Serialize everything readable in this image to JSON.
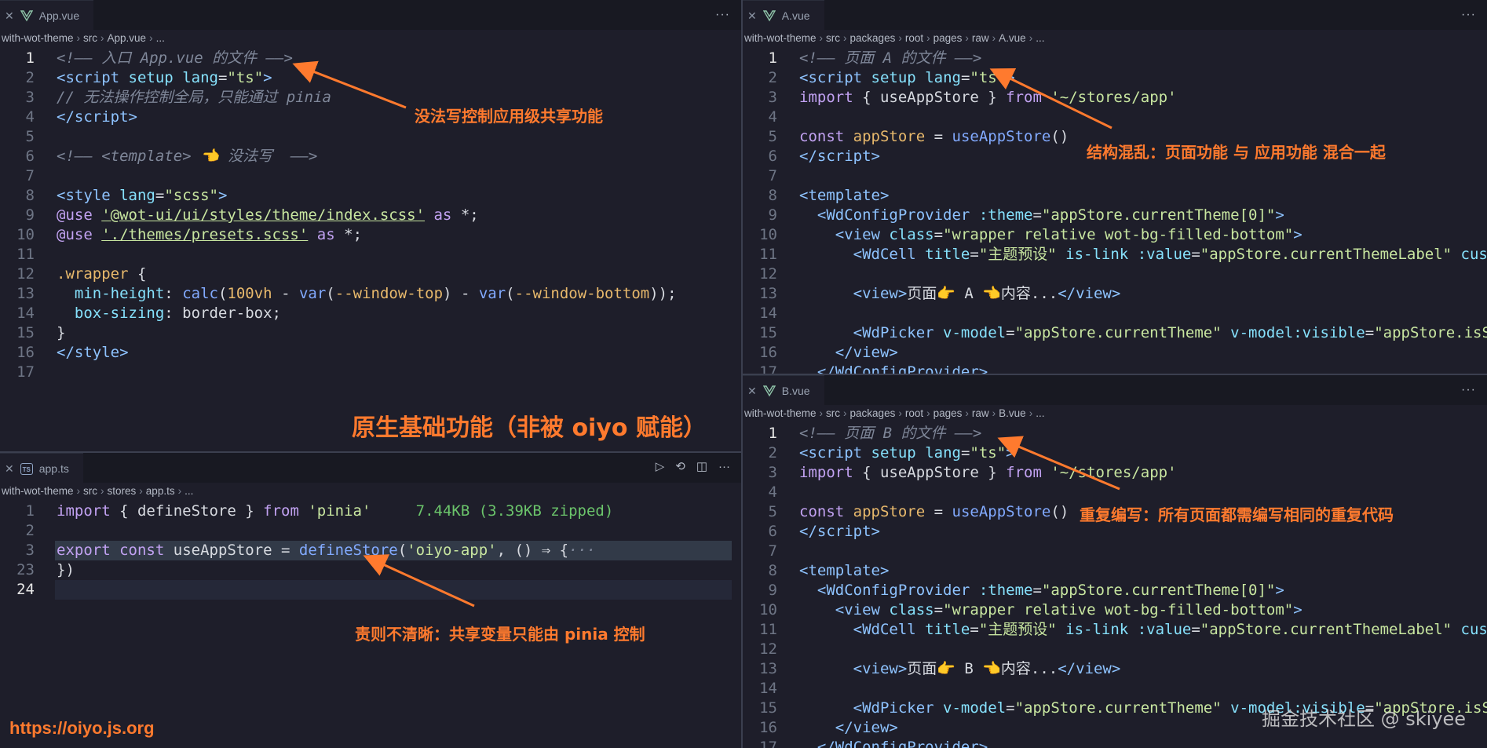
{
  "panes": {
    "app_vue": {
      "tab": "App.vue",
      "breadcrumb": [
        "with-wot-theme",
        "src",
        "App.vue",
        "..."
      ],
      "lines": [
        {
          "n": "1",
          "html": "<span class='c'>&lt;!—— 入口 App.vue 的文件 ——&gt;</span>"
        },
        {
          "n": "2",
          "html": "<span class='t'>&lt;script</span> <span class='a'>setup</span> <span class='a'>lang</span><span class='p'>=</span><span class='s'>\"ts\"</span><span class='t'>&gt;</span>"
        },
        {
          "n": "3",
          "html": "<span class='c'>// 无法操作控制全局，只能通过 pinia</span>"
        },
        {
          "n": "4",
          "html": "<span class='t'>&lt;/script&gt;</span>"
        },
        {
          "n": "5",
          "html": ""
        },
        {
          "n": "6",
          "html": "<span class='c'>&lt;!—— &lt;template&gt; 👈 没法写  ——&gt;</span>"
        },
        {
          "n": "7",
          "html": ""
        },
        {
          "n": "8",
          "html": "<span class='t'>&lt;style</span> <span class='a'>lang</span><span class='p'>=</span><span class='s'>\"scss\"</span><span class='t'>&gt;</span>"
        },
        {
          "n": "9",
          "html": "<span class='k'>@use</span> <span class='s u'>'@wot-ui/ui/styles/theme/index.scss'</span> <span class='k'>as</span> <span class='p'>*;</span>"
        },
        {
          "n": "10",
          "html": "<span class='k'>@use</span> <span class='s u'>'./themes/presets.scss'</span> <span class='k'>as</span> <span class='p'>*;</span>"
        },
        {
          "n": "11",
          "html": ""
        },
        {
          "n": "12",
          "html": "<span class='v'>.wrapper</span> <span class='p'>{</span>"
        },
        {
          "n": "13",
          "html": "  <span class='a'>min-height</span><span class='p'>:</span> <span class='f'>calc</span><span class='p'>(</span><span class='v'>100vh</span> <span class='p'>-</span> <span class='f'>var</span><span class='p'>(</span><span class='v'>--window-top</span><span class='p'>)</span> <span class='p'>-</span> <span class='f'>var</span><span class='p'>(</span><span class='v'>--window-bottom</span><span class='p'>));</span>"
        },
        {
          "n": "14",
          "html": "  <span class='a'>box-sizing</span><span class='p'>: border-box;</span>"
        },
        {
          "n": "15",
          "html": "<span class='p'>}</span>"
        },
        {
          "n": "16",
          "html": "<span class='t'>&lt;/style&gt;</span>"
        },
        {
          "n": "17",
          "html": ""
        }
      ]
    },
    "app_ts": {
      "tab": "app.ts",
      "breadcrumb": [
        "with-wot-theme",
        "src",
        "stores",
        "app.ts",
        "..."
      ],
      "lines": [
        {
          "n": "1",
          "html": "<span class='k'>import</span> <span class='p'>{ defineStore }</span> <span class='k'>from</span> <span class='s'>'pinia'</span>     <span class='g'>7.44KB (3.39KB zipped)</span>"
        },
        {
          "n": "2",
          "html": ""
        },
        {
          "n": "3",
          "html": "<span class='k'>export</span> <span class='k'>const</span> <span class='p'>useAppStore =</span> <span class='f'>defineStore</span><span class='p'>(</span><span class='s'>'oiyo-app'</span><span class='p'>, () ⇒ {</span><span class='c'>···</span>"
        },
        {
          "n": "23",
          "html": "<span class='p'>})</span>"
        },
        {
          "n": "24",
          "html": ""
        }
      ]
    },
    "a_vue": {
      "tab": "A.vue",
      "breadcrumb": [
        "with-wot-theme",
        "src",
        "packages",
        "root",
        "pages",
        "raw",
        "A.vue",
        "..."
      ],
      "lines": [
        {
          "n": "1",
          "html": "<span class='c'>&lt;!—— 页面 A 的文件 ——&gt;</span>"
        },
        {
          "n": "2",
          "html": "<span class='t'>&lt;script</span> <span class='a'>setup</span> <span class='a'>lang</span><span class='p'>=</span><span class='s'>\"ts\"</span><span class='t'>&gt;</span>"
        },
        {
          "n": "3",
          "html": "<span class='k'>import</span> <span class='p'>{ useAppStore }</span> <span class='k'>from</span> <span class='s'>'~/stores/app'</span>"
        },
        {
          "n": "4",
          "html": ""
        },
        {
          "n": "5",
          "html": "<span class='k'>const</span> <span class='v'>appStore</span> <span class='p'>=</span> <span class='f'>useAppStore</span><span class='p'>()</span>"
        },
        {
          "n": "6",
          "html": "<span class='t'>&lt;/script&gt;</span>"
        },
        {
          "n": "7",
          "html": ""
        },
        {
          "n": "8",
          "html": "<span class='t'>&lt;template&gt;</span>"
        },
        {
          "n": "9",
          "html": "  <span class='t'>&lt;WdConfigProvider</span> <span class='a'>:theme</span><span class='p'>=</span><span class='s'>\"appStore.currentTheme[0]\"</span><span class='t'>&gt;</span>"
        },
        {
          "n": "10",
          "html": "    <span class='t'>&lt;view</span> <span class='a'>class</span><span class='p'>=</span><span class='s'>\"wrapper relative wot-bg-filled-bottom\"</span><span class='t'>&gt;</span>"
        },
        {
          "n": "11",
          "html": "      <span class='t'>&lt;WdCell</span> <span class='a'>title</span><span class='p'>=</span><span class='s'>\"主题预设\"</span> <span class='a'>is-link</span> <span class='a'>:value</span><span class='p'>=</span><span class='s'>\"appStore.currentThemeLabel\"</span> <span class='a'>cus</span>"
        },
        {
          "n": "12",
          "html": ""
        },
        {
          "n": "13",
          "html": "      <span class='t'>&lt;view&gt;</span><span class='p'>页面👉 A 👈内容...</span><span class='t'>&lt;/view&gt;</span>"
        },
        {
          "n": "14",
          "html": ""
        },
        {
          "n": "15",
          "html": "      <span class='t'>&lt;WdPicker</span> <span class='a'>v-model</span><span class='p'>=</span><span class='s'>\"appStore.currentTheme\"</span> <span class='a'>v-model:visible</span><span class='p'>=</span><span class='s'>\"appStore.isS</span>"
        },
        {
          "n": "16",
          "html": "    <span class='t'>&lt;/view&gt;</span>"
        },
        {
          "n": "17",
          "html": "  <span class='t'>&lt;/WdConfigProvider&gt;</span>"
        }
      ]
    },
    "b_vue": {
      "tab": "B.vue",
      "breadcrumb": [
        "with-wot-theme",
        "src",
        "packages",
        "root",
        "pages",
        "raw",
        "B.vue",
        "..."
      ],
      "lines": [
        {
          "n": "1",
          "html": "<span class='c'>&lt;!—— 页面 B 的文件 ——&gt;</span>"
        },
        {
          "n": "2",
          "html": "<span class='t'>&lt;script</span> <span class='a'>setup</span> <span class='a'>lang</span><span class='p'>=</span><span class='s'>\"ts\"</span><span class='t'>&gt;</span>"
        },
        {
          "n": "3",
          "html": "<span class='k'>import</span> <span class='p'>{ useAppStore }</span> <span class='k'>from</span> <span class='s'>'~/stores/app'</span>"
        },
        {
          "n": "4",
          "html": ""
        },
        {
          "n": "5",
          "html": "<span class='k'>const</span> <span class='v'>appStore</span> <span class='p'>=</span> <span class='f'>useAppStore</span><span class='p'>()</span>"
        },
        {
          "n": "6",
          "html": "<span class='t'>&lt;/script&gt;</span>"
        },
        {
          "n": "7",
          "html": ""
        },
        {
          "n": "8",
          "html": "<span class='t'>&lt;template&gt;</span>"
        },
        {
          "n": "9",
          "html": "  <span class='t'>&lt;WdConfigProvider</span> <span class='a'>:theme</span><span class='p'>=</span><span class='s'>\"appStore.currentTheme[0]\"</span><span class='t'>&gt;</span>"
        },
        {
          "n": "10",
          "html": "    <span class='t'>&lt;view</span> <span class='a'>class</span><span class='p'>=</span><span class='s'>\"wrapper relative wot-bg-filled-bottom\"</span><span class='t'>&gt;</span>"
        },
        {
          "n": "11",
          "html": "      <span class='t'>&lt;WdCell</span> <span class='a'>title</span><span class='p'>=</span><span class='s'>\"主题预设\"</span> <span class='a'>is-link</span> <span class='a'>:value</span><span class='p'>=</span><span class='s'>\"appStore.currentThemeLabel\"</span> <span class='a'>cus</span>"
        },
        {
          "n": "12",
          "html": ""
        },
        {
          "n": "13",
          "html": "      <span class='t'>&lt;view&gt;</span><span class='p'>页面👉 B 👈内容...</span><span class='t'>&lt;/view&gt;</span>"
        },
        {
          "n": "14",
          "html": ""
        },
        {
          "n": "15",
          "html": "      <span class='t'>&lt;WdPicker</span> <span class='a'>v-model</span><span class='p'>=</span><span class='s'>\"appStore.currentTheme\"</span> <span class='a'>v-model:visible</span><span class='p'>=</span><span class='s'>\"appStore.isS</span>"
        },
        {
          "n": "16",
          "html": "    <span class='t'>&lt;/view&gt;</span>"
        },
        {
          "n": "17",
          "html": "  <span class='t'>&lt;/WdConfigProvider&gt;</span>"
        }
      ]
    }
  },
  "annotations": {
    "app_vue_note": "没法写控制应用级共享功能",
    "native_title": "原生基础功能（非被 oiyo 赋能）",
    "app_ts_note": "责则不清晰：共享变量只能由 pinia 控制",
    "a_vue_note": "结构混乱：页面功能 与 应用功能 混合一起",
    "b_vue_note": "重复编写：所有页面都需编写相同的重复代码"
  },
  "footer": {
    "url": "https://oiyo.js.org",
    "watermark": "掘金技术社区 @ skiyee"
  },
  "colors": {
    "accent": "#ff7a2e",
    "vue_green": "#42b883"
  }
}
